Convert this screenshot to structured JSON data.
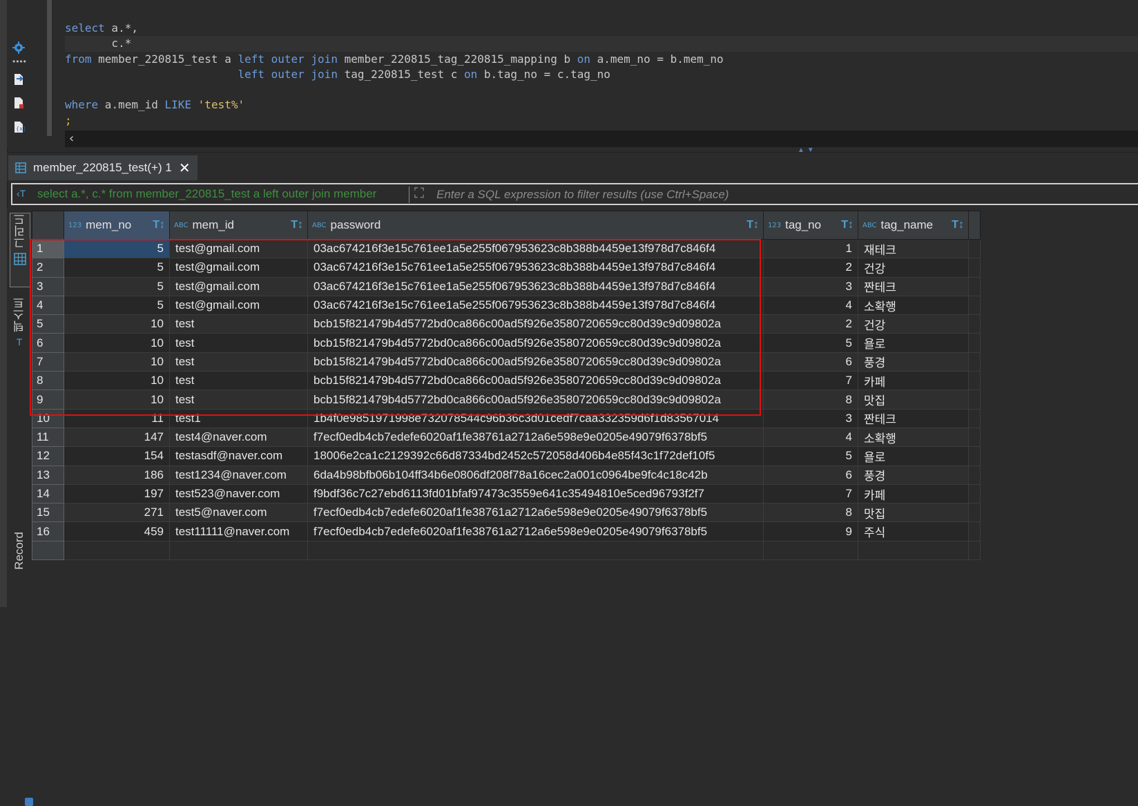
{
  "editor": {
    "lines": [
      [
        {
          "t": "kw",
          "v": "select"
        },
        {
          "t": "id",
          "v": " a.*,"
        }
      ],
      [
        {
          "t": "id",
          "v": "       c.*"
        }
      ],
      [
        {
          "t": "kw",
          "v": "from"
        },
        {
          "t": "id",
          "v": " member_220815_test a "
        },
        {
          "t": "kw",
          "v": "left outer join"
        },
        {
          "t": "id",
          "v": " member_220815_tag_220815_mapping b "
        },
        {
          "t": "kw",
          "v": "on"
        },
        {
          "t": "id",
          "v": " a.mem_no = b.mem_no"
        }
      ],
      [
        {
          "t": "id",
          "v": "                          "
        },
        {
          "t": "kw",
          "v": "left outer join"
        },
        {
          "t": "id",
          "v": " tag_220815_test c "
        },
        {
          "t": "kw",
          "v": "on"
        },
        {
          "t": "id",
          "v": " b.tag_no = c.tag_no"
        }
      ],
      [],
      [
        {
          "t": "kw",
          "v": "where"
        },
        {
          "t": "id",
          "v": " a.mem_id "
        },
        {
          "t": "kw",
          "v": "LIKE"
        },
        {
          "t": "id",
          "v": " "
        },
        {
          "t": "str",
          "v": "'test%'"
        }
      ],
      [
        {
          "t": "semi",
          "v": ";"
        }
      ]
    ],
    "current_line_index": 1
  },
  "result_tab": {
    "label": "member_220815_test(+) 1",
    "close": "✕"
  },
  "filter": {
    "query_text": "select a.*, c.* from member_220815_test a left outer join member",
    "placeholder": "Enter a SQL expression to filter results (use Ctrl+Space)",
    "value": ""
  },
  "side_tabs": {
    "grid": "그리드",
    "text": "텍스트",
    "record": "Record"
  },
  "grid": {
    "columns": [
      {
        "type": "123",
        "label": "mem_no",
        "numeric": true
      },
      {
        "type": "ABC",
        "label": "mem_id",
        "numeric": false
      },
      {
        "type": "ABC",
        "label": "password",
        "numeric": false
      },
      {
        "type": "123",
        "label": "tag_no",
        "numeric": true
      },
      {
        "type": "ABC",
        "label": "tag_name",
        "numeric": false
      }
    ],
    "rows": [
      [
        "5",
        "test@gmail.com",
        "03ac674216f3e15c761ee1a5e255f067953623c8b388b4459e13f978d7c846f4",
        "1",
        "재테크"
      ],
      [
        "5",
        "test@gmail.com",
        "03ac674216f3e15c761ee1a5e255f067953623c8b388b4459e13f978d7c846f4",
        "2",
        "건강"
      ],
      [
        "5",
        "test@gmail.com",
        "03ac674216f3e15c761ee1a5e255f067953623c8b388b4459e13f978d7c846f4",
        "3",
        "짠테크"
      ],
      [
        "5",
        "test@gmail.com",
        "03ac674216f3e15c761ee1a5e255f067953623c8b388b4459e13f978d7c846f4",
        "4",
        "소확행"
      ],
      [
        "10",
        "test",
        "bcb15f821479b4d5772bd0ca866c00ad5f926e3580720659cc80d39c9d09802a",
        "2",
        "건강"
      ],
      [
        "10",
        "test",
        "bcb15f821479b4d5772bd0ca866c00ad5f926e3580720659cc80d39c9d09802a",
        "5",
        "욜로"
      ],
      [
        "10",
        "test",
        "bcb15f821479b4d5772bd0ca866c00ad5f926e3580720659cc80d39c9d09802a",
        "6",
        "풍경"
      ],
      [
        "10",
        "test",
        "bcb15f821479b4d5772bd0ca866c00ad5f926e3580720659cc80d39c9d09802a",
        "7",
        "카페"
      ],
      [
        "10",
        "test",
        "bcb15f821479b4d5772bd0ca866c00ad5f926e3580720659cc80d39c9d09802a",
        "8",
        "맛집"
      ],
      [
        "11",
        "test1",
        "1b4f0e9851971998e732078544c96b36c3d01cedf7caa332359d6f1d83567014",
        "3",
        "짠테크"
      ],
      [
        "147",
        "test4@naver.com",
        "f7ecf0edb4cb7edefe6020af1fe38761a2712a6e598e9e0205e49079f6378bf5",
        "4",
        "소확행"
      ],
      [
        "154",
        "testasdf@naver.com",
        "18006e2ca1c2129392c66d87334bd2452c572058d406b4e85f43c1f72def10f5",
        "5",
        "욜로"
      ],
      [
        "186",
        "test1234@naver.com",
        "6da4b98bfb06b104ff34b6e0806df208f78a16cec2a001c0964be9fc4c18c42b",
        "6",
        "풍경"
      ],
      [
        "197",
        "test523@naver.com",
        "f9bdf36c7c27ebd6113fd01bfaf97473c3559e641c35494810e5ced96793f2f7",
        "7",
        "카페"
      ],
      [
        "271",
        "test5@naver.com",
        "f7ecf0edb4cb7edefe6020af1fe38761a2712a6e598e9e0205e49079f6378bf5",
        "8",
        "맛집"
      ],
      [
        "459",
        "test11111@naver.com",
        "f7ecf0edb4cb7edefe6020af1fe38761a2712a6e598e9e0205e49079f6378bf5",
        "9",
        "주식"
      ]
    ],
    "selected_row": 1,
    "highlighted_rows": [
      1,
      2,
      3,
      4,
      5,
      6,
      7,
      8,
      9
    ],
    "highlight_color": "#e01010"
  }
}
